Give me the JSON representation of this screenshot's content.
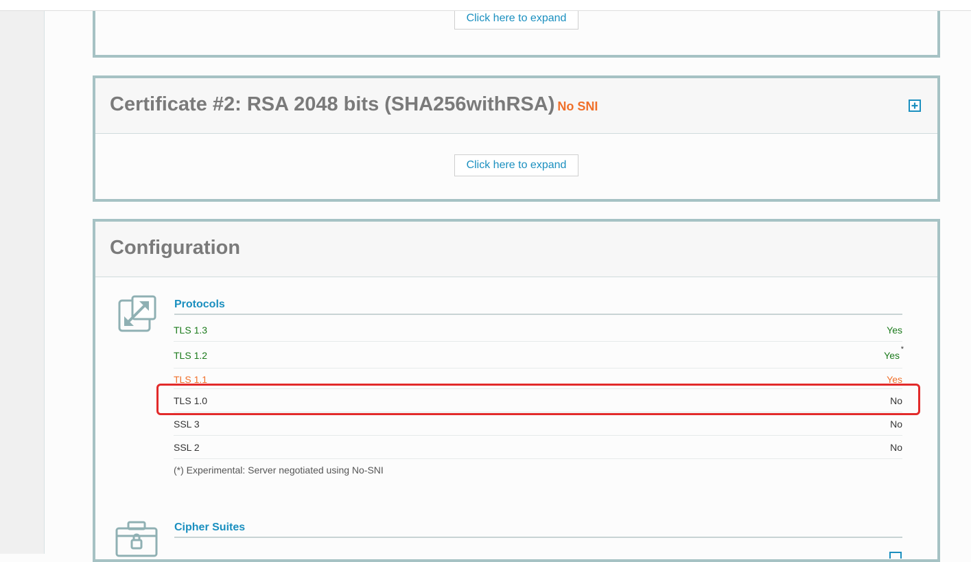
{
  "certificate_1": {
    "expand_label": "Click here to expand"
  },
  "certificate_2": {
    "title": "Certificate #2: RSA 2048 bits (SHA256withRSA)",
    "badge": "No SNI",
    "expand_label": "Click here to expand",
    "toggle_icon": "plus-square-icon"
  },
  "configuration": {
    "title": "Configuration",
    "protocols": {
      "heading": "Protocols",
      "icon": "expand-arrows-icon",
      "rows": [
        {
          "label": "TLS 1.3",
          "value": "Yes",
          "color": "#1b7a1b"
        },
        {
          "label": "TLS 1.2",
          "value": "Yes",
          "sup": "*",
          "color": "#1b7a1b"
        },
        {
          "label": "TLS 1.1",
          "value": "Yes",
          "color": "#f0702a"
        },
        {
          "label": "TLS 1.0",
          "value": "No",
          "color": "#333333"
        },
        {
          "label": "SSL 3",
          "value": "No",
          "color": "#333333"
        },
        {
          "label": "SSL 2",
          "value": "No",
          "color": "#333333"
        }
      ],
      "footnote": "(*) Experimental: Server negotiated using No-SNI"
    },
    "cipher_suites": {
      "heading": "Cipher Suites",
      "icon": "toolbox-lock-icon"
    }
  },
  "colors": {
    "accent": "#1a8fbf",
    "border": "#a6c2c4",
    "highlight": "#e22a2a"
  }
}
